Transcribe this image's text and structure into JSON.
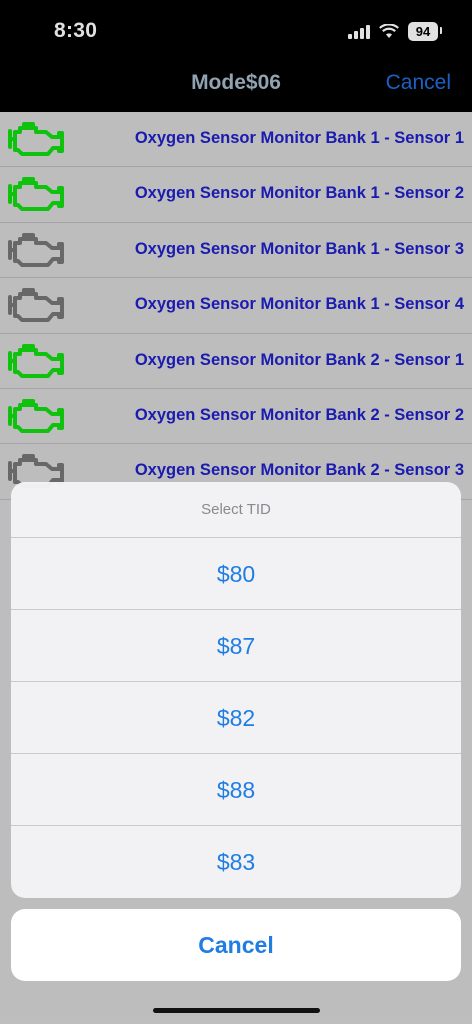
{
  "status": {
    "time": "8:30",
    "battery": "94"
  },
  "nav": {
    "title": "Mode$06",
    "cancel": "Cancel"
  },
  "colors": {
    "active": "#11dd11",
    "inactive": "#777777"
  },
  "list": {
    "items": [
      {
        "label": "Oxygen Sensor Monitor Bank 1 - Sensor 1",
        "status": "active"
      },
      {
        "label": "Oxygen Sensor Monitor Bank 1 - Sensor 2",
        "status": "active"
      },
      {
        "label": "Oxygen Sensor Monitor Bank 1 - Sensor 3",
        "status": "inactive"
      },
      {
        "label": "Oxygen Sensor Monitor Bank 1 - Sensor 4",
        "status": "inactive"
      },
      {
        "label": "Oxygen Sensor Monitor Bank 2 - Sensor 1",
        "status": "active"
      },
      {
        "label": "Oxygen Sensor Monitor Bank 2 - Sensor 2",
        "status": "active"
      },
      {
        "label": "Oxygen Sensor Monitor Bank 2 - Sensor 3",
        "status": "inactive"
      }
    ]
  },
  "sheet": {
    "title": "Select TID",
    "options": [
      "$80",
      "$87",
      "$82",
      "$88",
      "$83"
    ],
    "cancel": "Cancel"
  }
}
